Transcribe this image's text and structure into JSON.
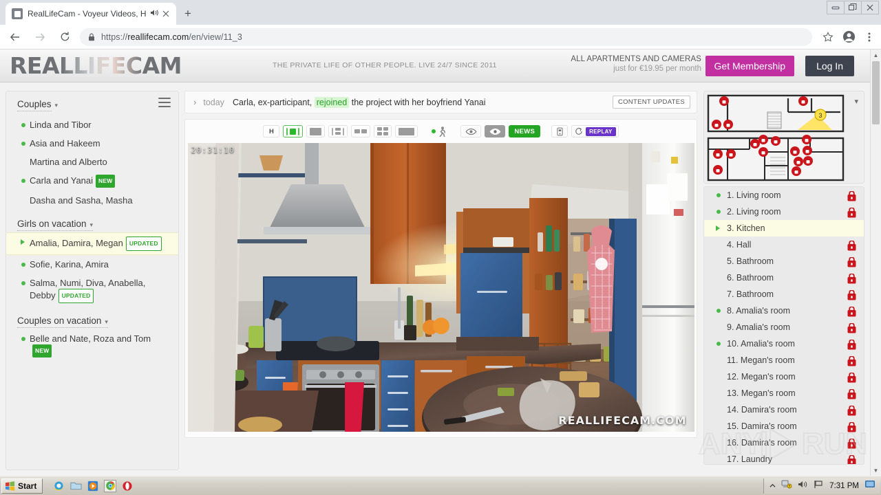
{
  "browser": {
    "tab": {
      "title": "RealLifeCam - Voyeur Videos, H",
      "audio_icon": "speaker-icon",
      "close_icon": "close-icon"
    },
    "newtab_label": "+",
    "url_scheme": "https://",
    "url_host": "reallifecam.com",
    "url_path": "/en/view/11_3",
    "window_controls": {
      "minimize": "minimize-icon",
      "maximize": "restore-icon",
      "close": "close-icon"
    }
  },
  "header": {
    "logo": "REALLIFECAM",
    "tagline": "THE PRIVATE LIFE OF OTHER PEOPLE. LIVE 24/7 SINCE 2011",
    "promo_line1": "ALL APARTMENTS AND CAMERAS",
    "promo_line2": "just for €19.95 per month",
    "membership_button": "Get Membership",
    "login_button": "Log In"
  },
  "sidebar": {
    "groups": [
      {
        "title": "Couples",
        "items": [
          {
            "label": "Linda and Tibor",
            "online": true,
            "badge": null,
            "selected": false
          },
          {
            "label": "Asia and Hakeem",
            "online": true,
            "badge": null,
            "selected": false
          },
          {
            "label": "Martina and Alberto",
            "online": false,
            "badge": null,
            "selected": false
          },
          {
            "label": "Carla and Yanai",
            "online": true,
            "badge": "NEW",
            "badge_style": "solid",
            "selected": false
          },
          {
            "label": "Dasha and Sasha, Masha",
            "online": false,
            "badge": null,
            "selected": false
          }
        ]
      },
      {
        "title": "Girls on vacation",
        "items": [
          {
            "label": "Amalia, Damira, Megan",
            "online": true,
            "badge": "UPDATED",
            "badge_style": "outline",
            "selected": true
          },
          {
            "label": "Sofie, Karina, Amira",
            "online": true,
            "badge": null,
            "selected": false
          },
          {
            "label": "Salma, Numi, Diva, Anabella, Debby",
            "online": true,
            "badge": "UPDATED",
            "badge_style": "outline",
            "selected": false
          }
        ]
      },
      {
        "title": "Couples on vacation",
        "items": [
          {
            "label": "Belle and Nate, Roza and Tom",
            "online": true,
            "badge": "NEW",
            "badge_style": "solid",
            "selected": false
          }
        ]
      }
    ]
  },
  "newsbar": {
    "arrow": "›",
    "date": "today",
    "text_before": "Carla, ex-participant,",
    "highlight": "rejoined",
    "text_after": "the project with her boyfriend Yanai",
    "content_updates_button": "CONTENT UPDATES"
  },
  "toolbar": {
    "buttons": [
      {
        "name": "hd-toggle",
        "label": "H",
        "type": "text",
        "selected": false
      },
      {
        "name": "layout-single-selected",
        "label": "",
        "type": "layout-1",
        "selected": true
      },
      {
        "name": "layout-full",
        "label": "",
        "type": "layout-full",
        "selected": false
      },
      {
        "name": "layout-split-left",
        "label": "",
        "type": "layout-split",
        "selected": false
      },
      {
        "name": "layout-two-up",
        "label": "",
        "type": "layout-2",
        "selected": false
      },
      {
        "name": "layout-quad",
        "label": "",
        "type": "layout-4",
        "selected": false
      },
      {
        "name": "layout-wide",
        "label": "",
        "type": "layout-wide",
        "selected": false
      },
      {
        "name": "motion-detect",
        "label": "",
        "type": "walk",
        "selected": false
      },
      {
        "name": "eye-view",
        "label": "",
        "type": "eye-light",
        "selected": false
      },
      {
        "name": "eye-view-dark",
        "label": "",
        "type": "eye-dark",
        "selected": false
      },
      {
        "name": "news-button",
        "label": "NEWS",
        "type": "news",
        "selected": false
      },
      {
        "name": "mobile-view",
        "label": "",
        "type": "mobile",
        "selected": false
      },
      {
        "name": "replay-button",
        "label": "REPLAY",
        "type": "replay",
        "selected": false
      }
    ]
  },
  "video": {
    "timestamp": "20:31:10",
    "watermark": "REALLIFECAM.COM",
    "scene": "kitchen"
  },
  "floorplan": {
    "camera_badge": "3",
    "collapse_icon": "chevron-down-icon",
    "lock_count_upper": 4,
    "lock_count_lower": 15
  },
  "rooms": [
    {
      "num": "1.",
      "label": "1. Living room",
      "online": true,
      "locked": true,
      "selected": false
    },
    {
      "num": "2.",
      "label": "2. Living room",
      "online": true,
      "locked": true,
      "selected": false
    },
    {
      "num": "3.",
      "label": "3. Kitchen",
      "online": true,
      "locked": false,
      "selected": true
    },
    {
      "num": "4.",
      "label": "4. Hall",
      "online": false,
      "locked": true,
      "selected": false
    },
    {
      "num": "5.",
      "label": "5. Bathroom",
      "online": false,
      "locked": true,
      "selected": false
    },
    {
      "num": "6.",
      "label": "6. Bathroom",
      "online": false,
      "locked": true,
      "selected": false
    },
    {
      "num": "7.",
      "label": "7. Bathroom",
      "online": false,
      "locked": true,
      "selected": false
    },
    {
      "num": "8.",
      "label": "8. Amalia's room",
      "online": true,
      "locked": true,
      "selected": false
    },
    {
      "num": "9.",
      "label": "9. Amalia's room",
      "online": false,
      "locked": true,
      "selected": false
    },
    {
      "num": "10.",
      "label": "10. Amalia's room",
      "online": true,
      "locked": true,
      "selected": false
    },
    {
      "num": "11.",
      "label": "11. Megan's room",
      "online": false,
      "locked": true,
      "selected": false
    },
    {
      "num": "12.",
      "label": "12. Megan's room",
      "online": false,
      "locked": true,
      "selected": false
    },
    {
      "num": "13.",
      "label": "13. Megan's room",
      "online": false,
      "locked": true,
      "selected": false
    },
    {
      "num": "14.",
      "label": "14. Damira's room",
      "online": false,
      "locked": true,
      "selected": false
    },
    {
      "num": "15.",
      "label": "15. Damira's room",
      "online": false,
      "locked": true,
      "selected": false
    },
    {
      "num": "16.",
      "label": "16. Damira's room",
      "online": false,
      "locked": true,
      "selected": false
    },
    {
      "num": "17.",
      "label": "17. Laundry",
      "online": false,
      "locked": true,
      "selected": false
    }
  ],
  "overlay_watermark": "ANY RUN",
  "taskbar": {
    "start_label": "Start",
    "quicklaunch": [
      "internet-explorer-icon",
      "folder-icon",
      "media-player-icon",
      "chrome-icon",
      "opera-icon"
    ],
    "tray_icons": [
      "chevron-up-icon",
      "network-icon",
      "volume-icon",
      "flag-icon"
    ],
    "clock": "7:31 PM"
  },
  "colors": {
    "accent_magenta": "#c12fa0",
    "login_dark": "#3d4450",
    "online_green": "#49b949",
    "lock_red": "#c9151b",
    "highlight_yellow": "#fcfbe3",
    "replay_purple": "#6a33c9"
  }
}
